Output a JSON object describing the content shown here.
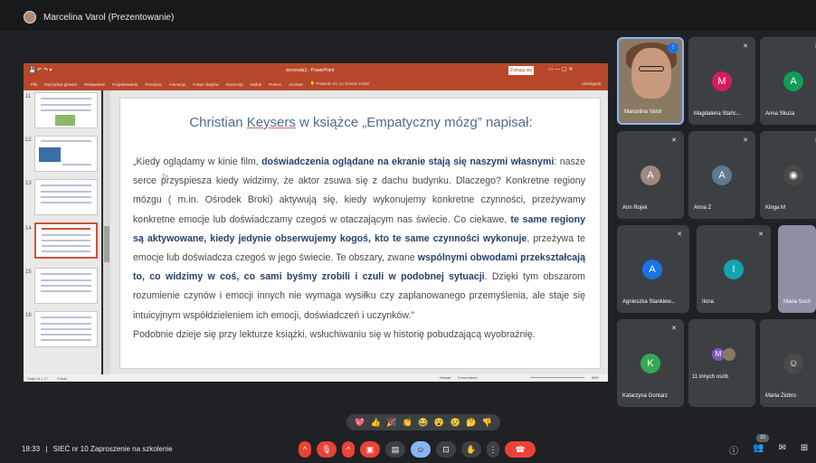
{
  "presenter": {
    "label": "Marcelina Varol (Prezentowanie)"
  },
  "powerpoint": {
    "file_title": "wcroroda1 - PowerPoint",
    "login_button": "Zaloguj się",
    "tell_me": "Powiedz mi, co chcesz zrobić",
    "share": "Udostępnij",
    "ribbon_tabs": [
      "Plik",
      "Narzędzia główne",
      "Wstawianie",
      "Projektowanie",
      "Przejścia",
      "Animacje",
      "Pokaz slajdów",
      "Recenzja",
      "Widok",
      "Pomoc",
      "Acrobat"
    ],
    "thumb_numbers": [
      "11",
      "12",
      "13",
      "14",
      "15",
      "16"
    ],
    "status_left": "Slajd 14 z 17",
    "status_lang": "Polski",
    "status_notes": "Notatki",
    "status_comments": "Komentarze",
    "zoom": "96%"
  },
  "slide": {
    "title_prefix": "Christian ",
    "title_name": "Keysers",
    "title_suffix": " w książce „Empatyczny mózg” napisał:",
    "t1": "„Kiedy oglądamy w kinie film, ",
    "b1": "doświadczenia oglądane na ekranie stają się naszymi własnymi",
    "t2": ": nasze serce przyspiesza kiedy widzimy, że aktor zsuwa się z dachu budynku. Dlaczego? Konkretne regiony mózgu ( m.in. Ośrodek Broki) aktywują się, kiedy wykonujemy konkretne czynności, przeżywamy konkretne emocje lub doświadczamy czegoś w otaczającym nas świecie. Co ciekawe, ",
    "b2": "te same regiony są aktywowane, kiedy jedynie obserwujemy kogoś, kto te same czynności wykonuje",
    "t3": ", przeżywa te emocje lub doświadcza czegoś w jego świecie. Te obszary, zwane ",
    "b3": "wspólnymi obwodami przekształcają to, co widzimy w coś, co sami byśmy zrobili i czuli w podobnej sytuacji",
    "t4": ". Dzięki tym obszarom rozumienie czynów i emocji innych nie wymaga wysiłku czy zaplanowanego przemyślenia, ale staje się intuicyjnym współdzieleniem ich emocji, doświadczeń i uczynków.”",
    "last": "Podobnie dzieje się przy lekturze książki, wsłuchiwaniu się w historię pobudzającą wyobraźnię."
  },
  "participants": [
    {
      "name": "Marcelina Varol",
      "type": "video"
    },
    {
      "name": "Magdalena Stańc...",
      "initial": "M",
      "color": "#d81b60"
    },
    {
      "name": "Anna Skuza",
      "initial": "A",
      "color": "#0f9d58"
    },
    {
      "name": "Ann Rojek",
      "initial": "A",
      "color": "#a1887f"
    },
    {
      "name": "Anna Z",
      "initial": "A",
      "color": "#5f7a8c"
    },
    {
      "name": "Kinga M",
      "initial": "",
      "color": "#4a4a4a"
    },
    {
      "name": "Agnieszka Stankiew...",
      "initial": "A",
      "color": "#1a73e8"
    },
    {
      "name": "Ilona",
      "initial": "I",
      "color": "#12a4af"
    },
    {
      "name": "Maria Soch",
      "initial": "",
      "color": "#8d8fa3"
    },
    {
      "name": "Katarzyna Gontarz",
      "initial": "K",
      "color": "#34a853"
    },
    {
      "name": "11 innych osób",
      "initial": "M",
      "color": "#7e57c2"
    },
    {
      "name": "Marta Ziobro",
      "initial": "",
      "color": "#4a4a4a"
    }
  ],
  "reactions": [
    "💖",
    "👍",
    "🎉",
    "👏",
    "😂",
    "😮",
    "😢",
    "🤔",
    "👎"
  ],
  "meeting": {
    "time": "18:33",
    "separator": "|",
    "name": "SIEĆ nr 10 Zaproszenie na szkolenie"
  },
  "people_count": "23",
  "icons": {
    "mic": "mic-off-icon",
    "camera": "camera-off-icon",
    "captions": "captions-icon",
    "emoji": "emoji-icon",
    "present": "present-icon",
    "hand": "raise-hand-icon",
    "more": "more-icon",
    "end": "end-call-icon",
    "info": "info-icon",
    "people": "people-icon",
    "chat": "chat-icon",
    "activities": "activities-icon"
  }
}
